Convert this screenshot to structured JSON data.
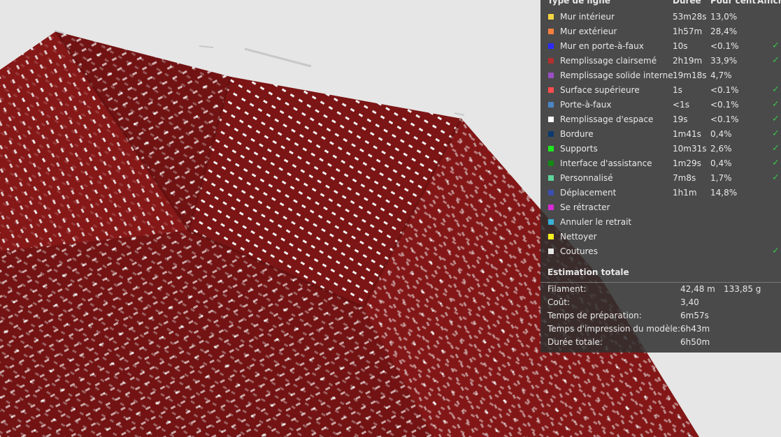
{
  "legend": {
    "headers": {
      "type": "Type de ligne",
      "duration": "Durée",
      "percent": "Pour cent",
      "show": "Affich"
    },
    "rows": [
      {
        "label": "Mur intérieur",
        "duration": "53m28s",
        "percent": "13,0%",
        "color": "#f4d540",
        "checked": false
      },
      {
        "label": "Mur extérieur",
        "duration": "1h57m",
        "percent": "28,4%",
        "color": "#ff7f3f",
        "checked": false
      },
      {
        "label": "Mur en porte-à-faux",
        "duration": "10s",
        "percent": "<0.1%",
        "color": "#2b2bff",
        "checked": true
      },
      {
        "label": "Remplissage clairsemé",
        "duration": "2h19m",
        "percent": "33,9%",
        "color": "#b23030",
        "checked": true
      },
      {
        "label": "Remplissage solide interne",
        "duration": "19m18s",
        "percent": "4,7%",
        "color": "#9a4fc4",
        "checked": false
      },
      {
        "label": "Surface supérieure",
        "duration": "1s",
        "percent": "<0.1%",
        "color": "#ff4d4d",
        "checked": true
      },
      {
        "label": "Porte-à-faux",
        "duration": "<1s",
        "percent": "<0.1%",
        "color": "#4a86c5",
        "checked": true
      },
      {
        "label": "Remplissage d'espace",
        "duration": "19s",
        "percent": "<0.1%",
        "color": "#ffffff",
        "checked": true
      },
      {
        "label": "Bordure",
        "duration": "1m41s",
        "percent": "0,4%",
        "color": "#0b3a6e",
        "checked": true
      },
      {
        "label": "Supports",
        "duration": "10m31s",
        "percent": "2,6%",
        "color": "#1ee81e",
        "checked": true
      },
      {
        "label": "Interface d'assistance",
        "duration": "1m29s",
        "percent": "0,4%",
        "color": "#138a13",
        "checked": true
      },
      {
        "label": "Personnalisé",
        "duration": "7m8s",
        "percent": "1,7%",
        "color": "#5fd39a",
        "checked": true
      },
      {
        "label": "Déplacement",
        "duration": "1h1m",
        "percent": "14,8%",
        "color": "#3a4fb0",
        "checked": false
      },
      {
        "label": "Se rétracter",
        "duration": "",
        "percent": "",
        "color": "#d62bd6",
        "checked": false
      },
      {
        "label": "Annuler le retrait",
        "duration": "",
        "percent": "",
        "color": "#3ab0d6",
        "checked": false
      },
      {
        "label": "Nettoyer",
        "duration": "",
        "percent": "",
        "color": "#f5f01e",
        "checked": false
      },
      {
        "label": "Coutures",
        "duration": "",
        "percent": "",
        "color": "#e6e6e6",
        "checked": true
      }
    ]
  },
  "estimate": {
    "title": "Estimation totale",
    "rows": [
      {
        "key": "Filament:",
        "value": "42,48 m",
        "value2": "133,85 g"
      },
      {
        "key": "Coût:",
        "value": "3,40",
        "value2": ""
      },
      {
        "key": "Temps de préparation:",
        "value": "6m57s",
        "value2": ""
      },
      {
        "key": "Temps d'impression du modèle:",
        "value": "6h43m",
        "value2": ""
      },
      {
        "key": "Durée totale:",
        "value": "6h50m",
        "value2": ""
      }
    ]
  },
  "colors": {
    "model": "#7e1616",
    "background": "#e6e6e6",
    "check": "#39c24a"
  }
}
